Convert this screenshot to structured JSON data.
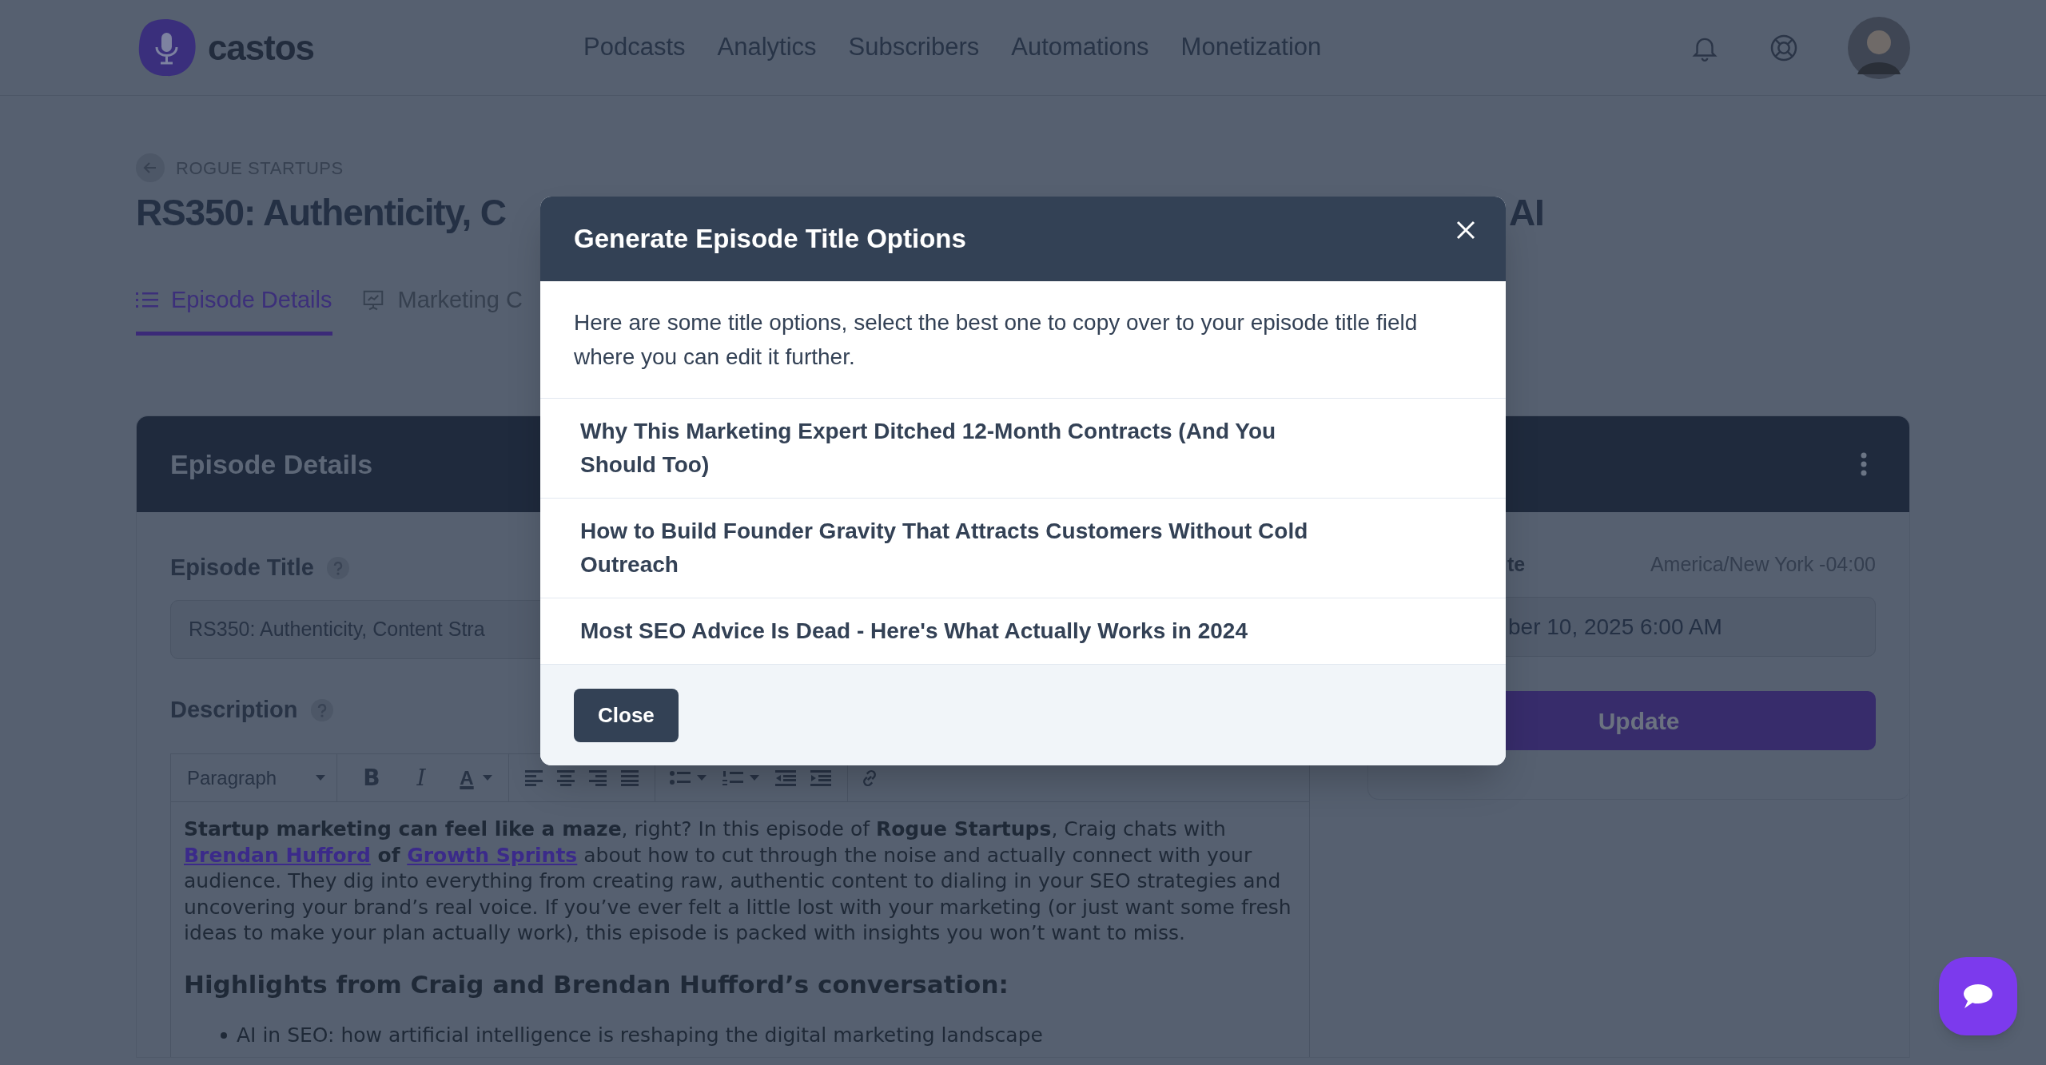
{
  "header": {
    "logo": "castos",
    "nav": [
      {
        "label": "Podcasts"
      },
      {
        "label": "Analytics"
      },
      {
        "label": "Subscribers"
      },
      {
        "label": "Automations"
      },
      {
        "label": "Monetization"
      }
    ]
  },
  "breadcrumb": "ROGUE STARTUPS",
  "title_parts": [
    "RS350: Authenticity, C",
    "AI"
  ],
  "tabs": [
    {
      "label": "Episode Details",
      "selected": true
    },
    {
      "label": "Marketing C",
      "selected": false
    }
  ],
  "details_card": {
    "title": "Episode Details",
    "episode_title_label": "Episode Title",
    "episode_title_value": "RS350: Authenticity, Content Stra",
    "description_label": "Description",
    "toolbar": {
      "block_format": "Paragraph",
      "bold": "B",
      "italic": "I",
      "text_color": "A"
    },
    "description": [
      {
        "kind": "bold",
        "text": "Startup marketing can feel like a maze"
      },
      {
        "kind": "plain",
        "text": ", right? In this episode of "
      },
      {
        "kind": "bold",
        "text": "Rogue Startups"
      },
      {
        "kind": "plain",
        "text": ", Craig chats with "
      },
      {
        "kind": "link",
        "text": "Brendan Hufford"
      },
      {
        "kind": "bold",
        "text": " of "
      },
      {
        "kind": "link",
        "text": "Growth Sprints"
      },
      {
        "kind": "plain",
        "text": " about how to cut through the noise and actually connect with your audience. They dig into everything from creating raw, authentic content to dialing in your SEO strategies and uncovering your brand’s real voice. If you’ve ever felt a little lost with your marketing (or just want some fresh ideas to make your plan actually work), this episode is packed with insights you won’t want to miss."
      }
    ],
    "highlights_heading": "Highlights from Craig and Brendan Hufford’s conversation:",
    "bullets": [
      "AI in SEO: how artificial intelligence is reshaping the digital marketing landscape"
    ]
  },
  "schedule": {
    "label": "te",
    "timezone": "America/New York -04:00",
    "date_value": "ber 10, 2025 6:00 AM",
    "button": "Update"
  },
  "modal": {
    "title": "Generate Episode Title Options",
    "intro": "Here are some title options, select the best one to copy over to your episode title field where you can edit it further.",
    "options": [
      {
        "text": "Why This Marketing Expert Ditched 12-Month Contracts (And You Should Too)"
      },
      {
        "text": "How to Build Founder Gravity That Attracts Customers Without Cold Outreach"
      },
      {
        "text": "Most SEO Advice Is Dead - Here's What Actually Works in 2024"
      }
    ],
    "close_button": "Close"
  }
}
